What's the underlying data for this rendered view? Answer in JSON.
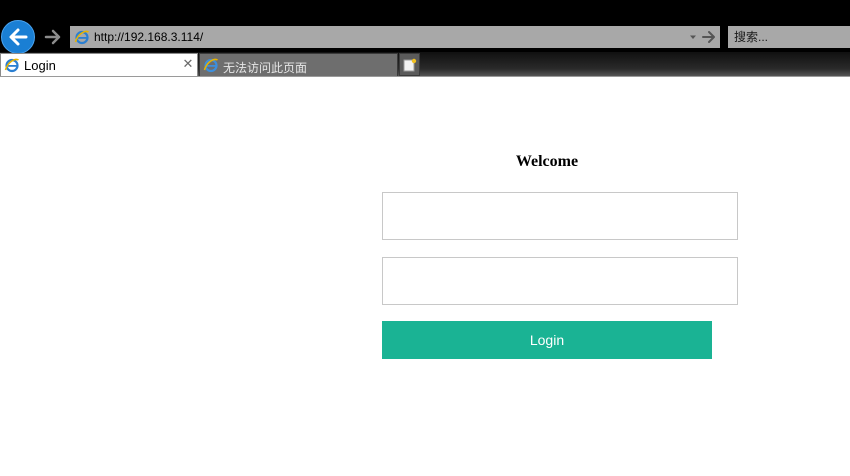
{
  "browser": {
    "address_url": "http://192.168.3.114/",
    "search_placeholder": "搜索...",
    "tabs": [
      {
        "label": "Login",
        "active": true,
        "close_glyph": "✕"
      },
      {
        "label": "无法访问此页面",
        "active": false
      }
    ],
    "icons": {
      "back": "back-arrow-icon",
      "forward": "forward-arrow-icon",
      "address_site": "ie-page-icon",
      "dropdown": "dropdown-caret-icon",
      "go": "go-arrow-icon",
      "new_tab": "new-tab-icon"
    }
  },
  "page": {
    "heading": "Welcome",
    "username_value": "",
    "password_value": "",
    "login_label": "Login"
  },
  "colors": {
    "login_button": "#1ab394",
    "back_button": "#1a7fd4",
    "chrome_background": "#000000",
    "address_bar": "#a8a8a8"
  }
}
